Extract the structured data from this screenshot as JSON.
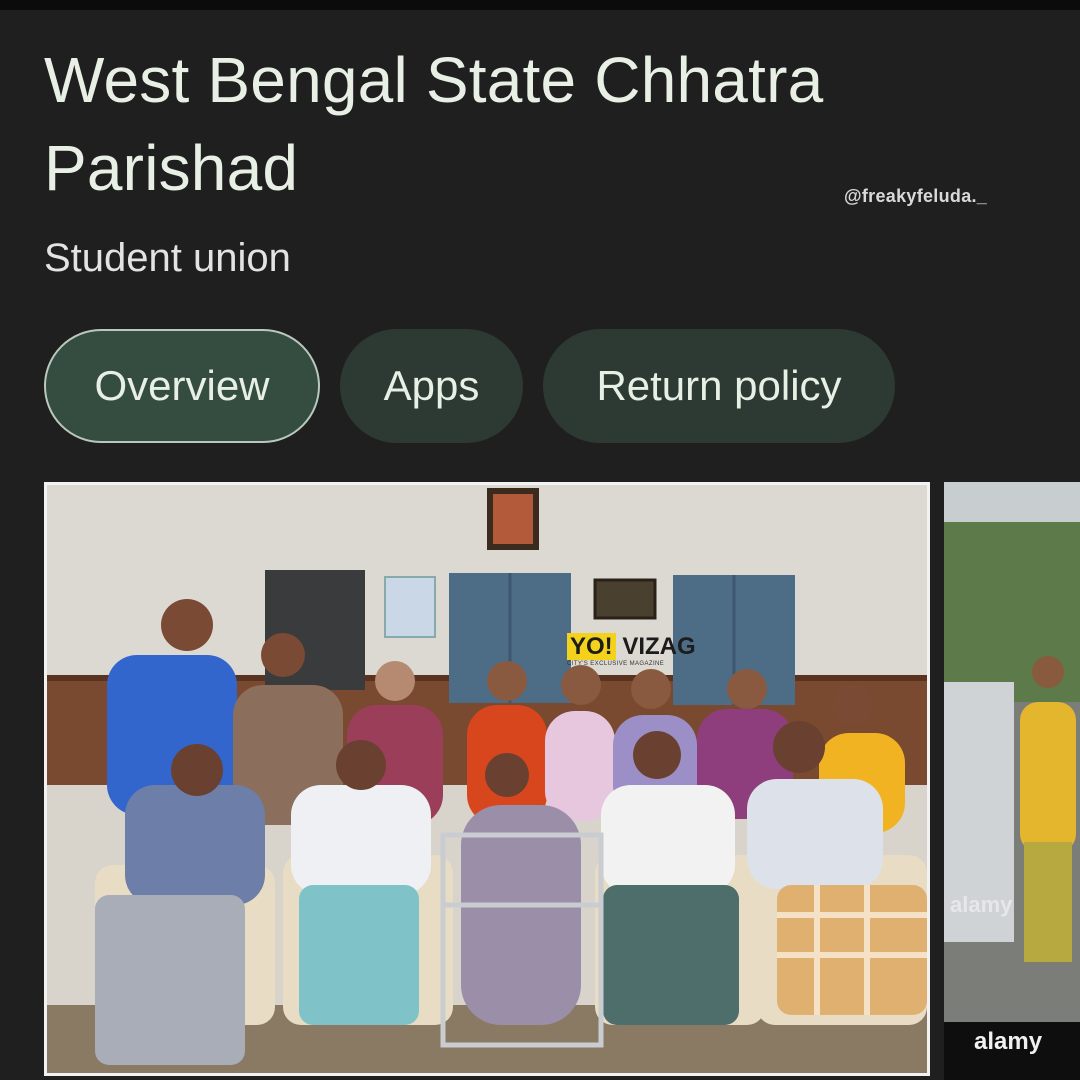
{
  "header": {
    "title": "West Bengal State Chhatra Parishad",
    "subtitle": "Student union"
  },
  "watermark": "@freakyfeluda._",
  "tabs": [
    {
      "label": "Overview",
      "active": true
    },
    {
      "label": "Apps",
      "active": false
    },
    {
      "label": "Return policy",
      "active": false
    }
  ],
  "images": {
    "main": {
      "logo_brand": "YO! VIZAG",
      "logo_sub": "CITY'S EXCLUSIVE MAGAZINE"
    },
    "side": {
      "watermark_1": "alamy",
      "watermark_2": "alamy"
    }
  },
  "colors": {
    "background": "#1f1f1f",
    "chip_active": "#354d40",
    "chip": "#2c3a33",
    "text": "#e8f0e6"
  }
}
